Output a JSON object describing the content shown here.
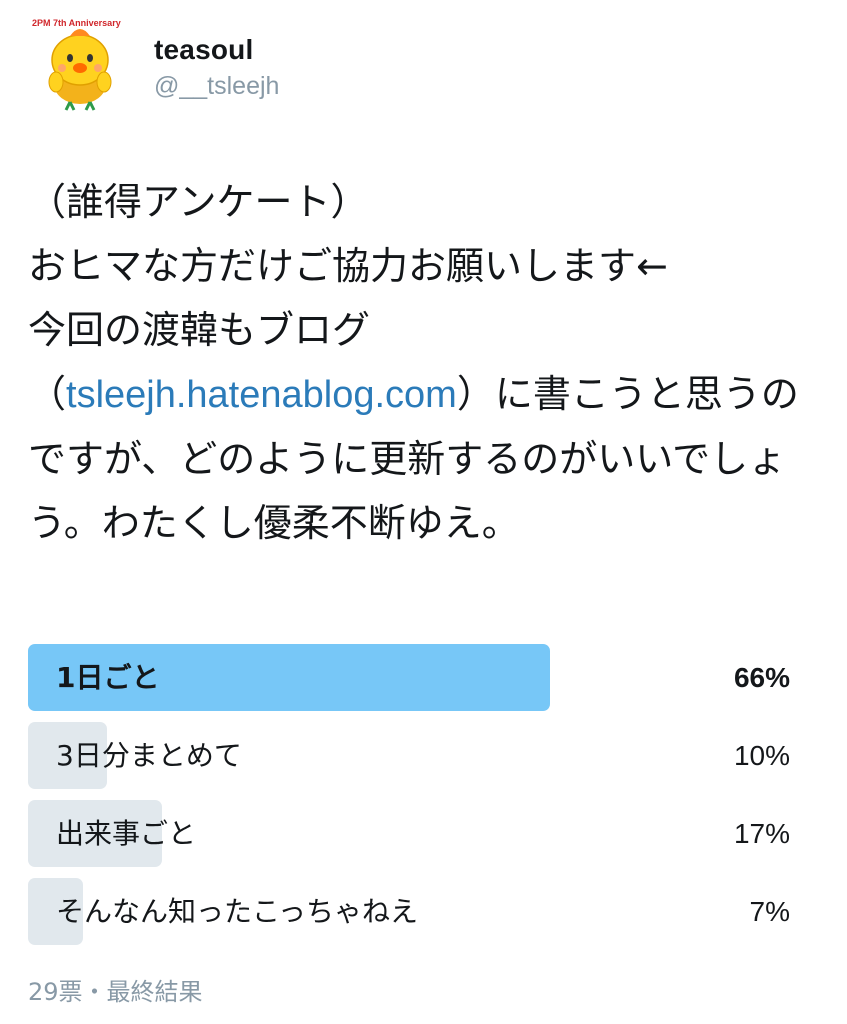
{
  "user": {
    "display_name": "teasoul",
    "handle": "@__tsleejh",
    "avatar_icon": "chick-mascot-avatar",
    "avatar_badge_text": "2PM 7th Anniversary"
  },
  "tweet": {
    "text_before_link": "（誰得アンケート）\nおヒマな方だけご協力お願いします←\n今回の渡韓もブログ\n（",
    "link_text": "tsleejh.hatenablog.com",
    "text_after_link": "）に書こうと思うのですが、どのように更新するのがいいでしょう。わたくし優柔不断ゆえ。",
    "link_color": "#2b7bb9"
  },
  "poll": {
    "options": [
      {
        "label": "1日ごと",
        "percent_text": "66%",
        "percent": 66,
        "winner": true
      },
      {
        "label": "3日分まとめて",
        "percent_text": "10%",
        "percent": 10,
        "winner": false
      },
      {
        "label": "出来事ごと",
        "percent_text": "17%",
        "percent": 17,
        "winner": false
      },
      {
        "label": "そんなん知ったこっちゃねえ",
        "percent_text": "7%",
        "percent": 7,
        "winner": false
      }
    ],
    "footer": "29票・最終結果",
    "winner_color": "#77c7f7",
    "bar_color": "#e1e8ed"
  }
}
